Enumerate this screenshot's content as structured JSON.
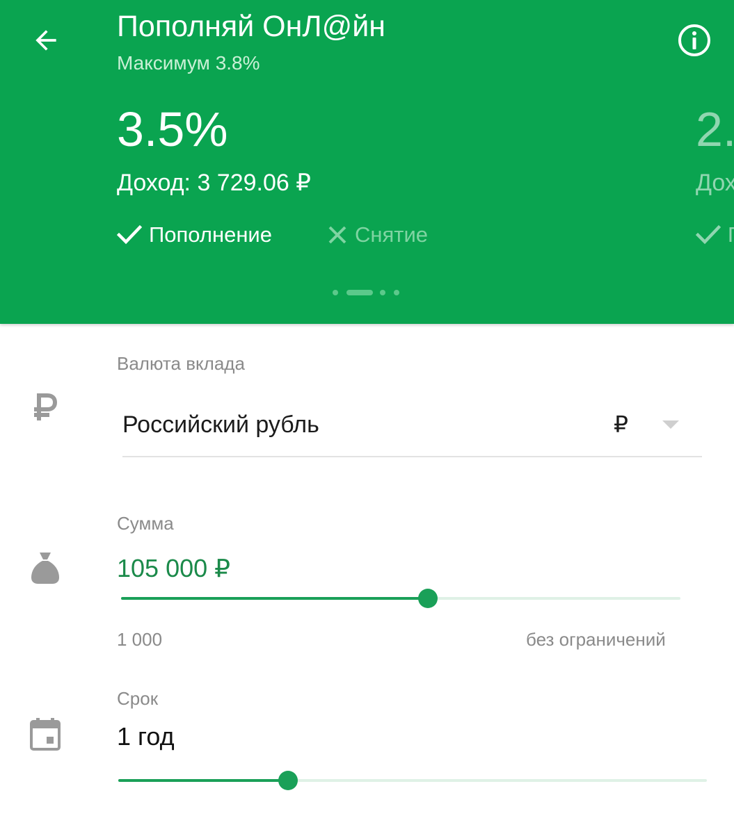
{
  "header": {
    "title": "Пополняй ОнЛ@йн",
    "subtitle": "Максимум 3.8%",
    "background_color": "#0aa450",
    "back_icon": "arrow-left-icon",
    "info_icon": "info-circle-icon",
    "cards": [
      {
        "rate": "3.5%",
        "income": "Доход: 3 729.06 ₽",
        "features": [
          {
            "label": "Пополнение",
            "enabled": true,
            "icon": "check-icon"
          },
          {
            "label": "Снятие",
            "enabled": false,
            "icon": "cross-icon"
          }
        ]
      },
      {
        "rate": "2.",
        "income": "Дох",
        "features": [
          {
            "label": "П",
            "enabled": true,
            "icon": "check-icon"
          }
        ]
      }
    ],
    "pager": {
      "count": 4,
      "active_index": 1
    }
  },
  "currency": {
    "label": "Валюта вклада",
    "value": "Российский рубль",
    "symbol": "₽",
    "icon": "ruble-icon"
  },
  "amount": {
    "label": "Сумма",
    "value": "105 000 ₽",
    "min_label": "1 000",
    "max_label": "без ограничений",
    "slider_fraction": 0.548,
    "icon": "money-bag-icon"
  },
  "term": {
    "label": "Срок",
    "value": "1 год",
    "slider_fraction": 0.288,
    "icon": "calendar-icon"
  },
  "colors": {
    "accent": "#1aa058",
    "track": "#dff1e6",
    "amount_text": "#1b8a4a"
  }
}
